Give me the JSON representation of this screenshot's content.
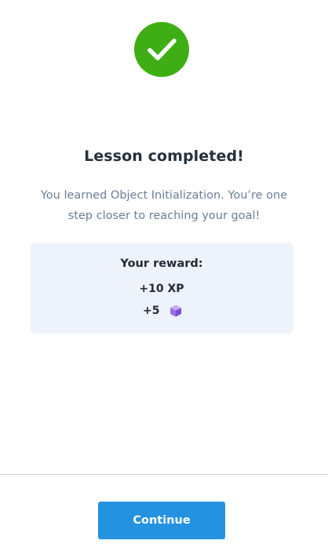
{
  "status": {
    "icon": "checkmark-icon",
    "color": "#3fae14"
  },
  "lesson": {
    "title": "Lesson completed!",
    "message": "You learned Object Initialization. You’re one step closer to reaching your goal!"
  },
  "reward": {
    "title": "Your reward:",
    "xp": "+10 XP",
    "gems": "+5",
    "gem_icon": "gem-cube-icon",
    "gem_color": "#9b6ee8"
  },
  "footer": {
    "continue_label": "Continue",
    "button_color": "#2492e0"
  }
}
